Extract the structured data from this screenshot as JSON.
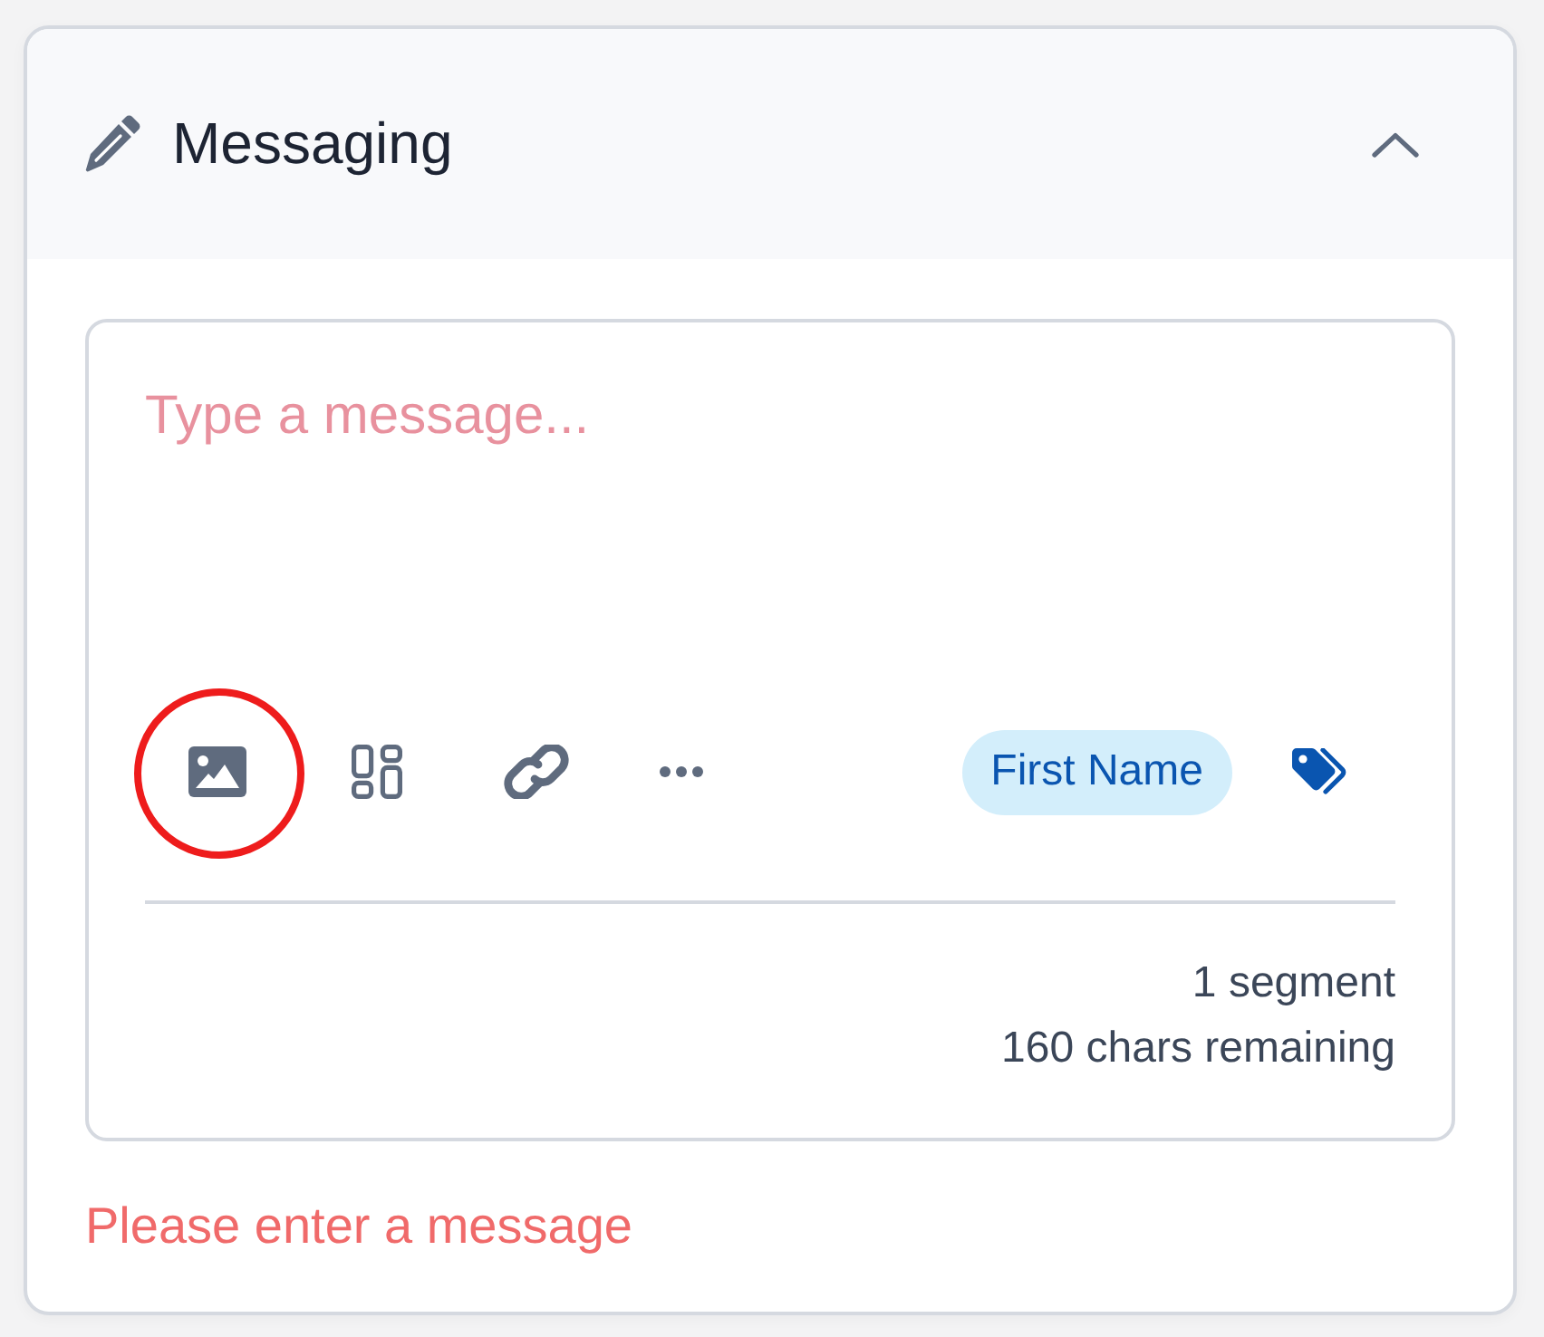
{
  "panel": {
    "title": "Messaging",
    "expanded": true
  },
  "composer": {
    "placeholder": "Type a message...",
    "tools": [
      {
        "kind": "image",
        "highlighted": true
      },
      {
        "kind": "grid",
        "highlighted": false
      },
      {
        "kind": "link",
        "highlighted": false
      },
      {
        "kind": "more",
        "highlighted": false
      }
    ],
    "merge_tag": {
      "label": "First Name"
    },
    "segment_count": "1 segment",
    "chars_remaining": "160 chars remaining"
  },
  "error": "Please enter a message"
}
